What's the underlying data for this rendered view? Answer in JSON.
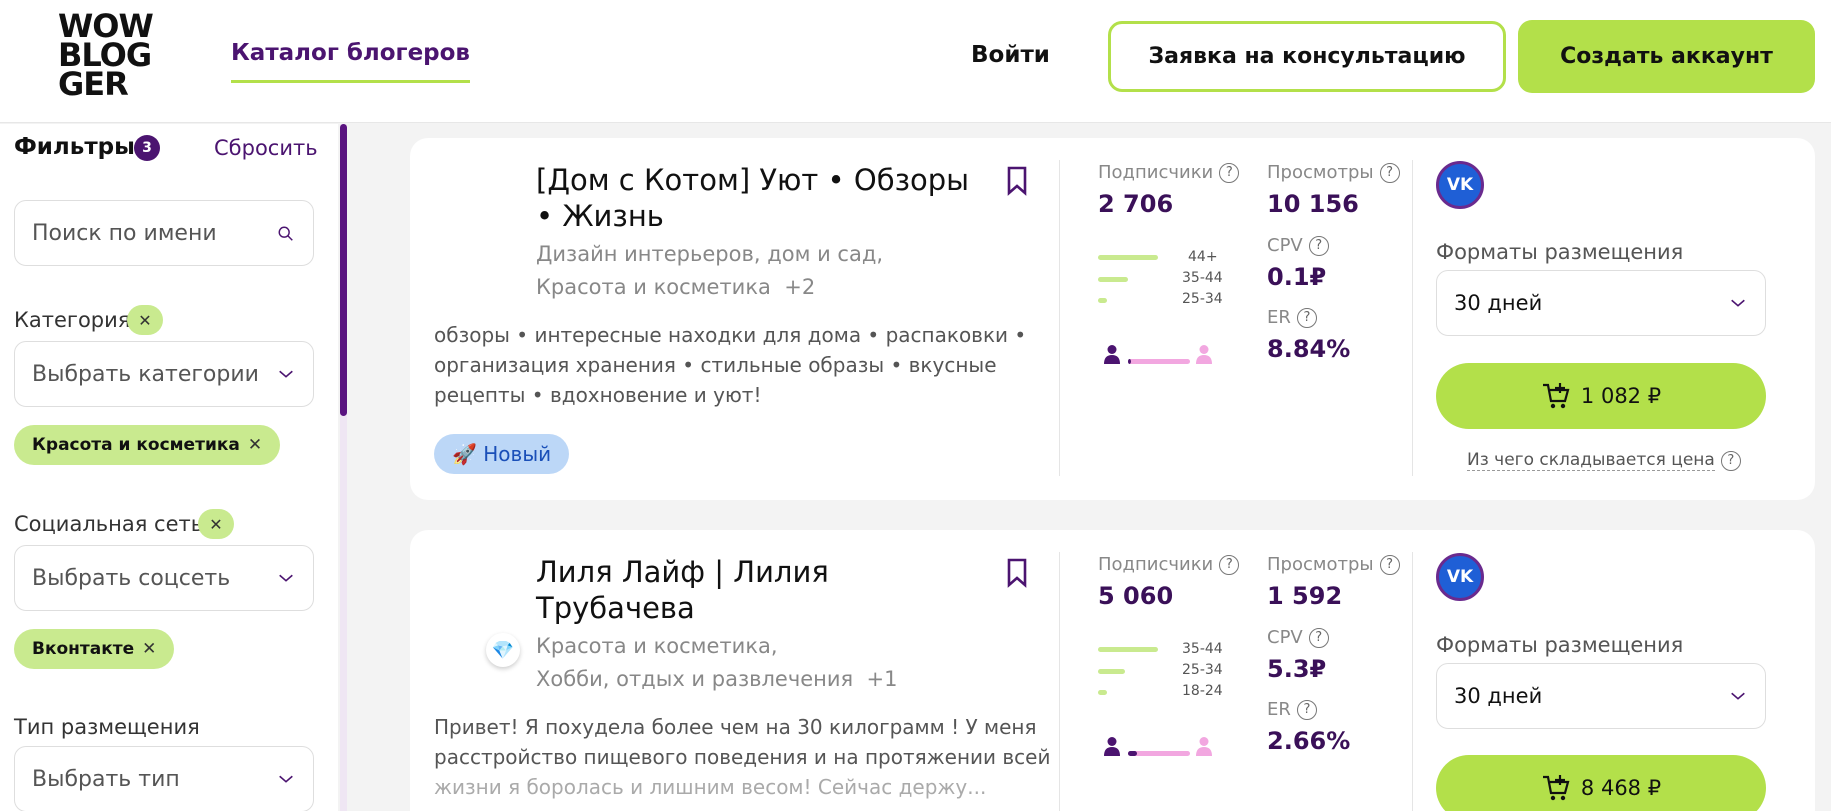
{
  "header": {
    "logo": [
      "WOW",
      "BLOG",
      "GER"
    ],
    "nav_catalog": "Каталог блогеров",
    "login": "Войти",
    "consult_btn": "Заявка на консультацию",
    "create_btn": "Создать аккаунт",
    "accent_color": "#b3e04a",
    "brand_color": "#4b1470"
  },
  "filters": {
    "title": "Фильтры",
    "count": "3",
    "reset": "Сбросить",
    "search_placeholder": "Поиск по имени",
    "category_label": "Категория",
    "category_placeholder": "Выбрать категории",
    "category_tag": "Красота и косметика",
    "social_label": "Социальная сеть",
    "social_placeholder": "Выбрать соцсеть",
    "social_tag": "Вконтакте",
    "type_label": "Тип размещения",
    "type_placeholder": "Выбрать тип"
  },
  "cards": [
    {
      "title_line1": "[Дом с Котом] Уют • Обзоры",
      "title_line2": "• Жизнь",
      "cats_line1": "Дизайн интерьеров, дом и сад,",
      "cats_line2": "Красота и косметика",
      "cats_more": "+2",
      "desc_line1": "обзоры • интересные находки для дома • распаковки •",
      "desc_line2": "организация хранения • стильные образы • вкусные",
      "desc_line3": "рецепты • вдохновение и уют!",
      "badge": "🚀 Новый",
      "subs_label": "Подписчики",
      "subs": "2 706",
      "views_label": "Просмотры",
      "views": "10 156",
      "cpv_label": "CPV",
      "cpv": "0.1₽",
      "er_label": "ER",
      "er": "8.84%",
      "ages": [
        "44+",
        "35-44",
        "25-34"
      ],
      "age_shares": [
        1.0,
        0.5,
        0.15
      ],
      "male_share": 0.05,
      "network": "VK",
      "formats_label": "Форматы размещения",
      "format": "30 дней",
      "price": "1 082 ₽",
      "price_note": "Из чего складывается цена"
    },
    {
      "title_line1": "Лиля Лайф | Лилия",
      "title_line2": "Трубачева",
      "cats_line1": "Красота и косметика,",
      "cats_line2": "Хобби, отдых и развлечения",
      "cats_more": "+1",
      "desc_line1": "Привет! Я похудела более чем на 30 килограмм ! У меня",
      "desc_line2": "расстройство пищевого поведения и на протяжении всей",
      "desc_line3": "жизни я боролась и лишним весом! Сейчас держу...",
      "subs_label": "Подписчики",
      "subs": "5 060",
      "views_label": "Просмотры",
      "views": "1 592",
      "cpv_label": "CPV",
      "cpv": "5.3₽",
      "er_label": "ER",
      "er": "2.66%",
      "ages": [
        "35-44",
        "25-34",
        "18-24"
      ],
      "age_shares": [
        1.0,
        0.45,
        0.15
      ],
      "male_share": 0.15,
      "network": "VK",
      "formats_label": "Форматы размещения",
      "format": "30 дней",
      "price": "8 468 ₽"
    }
  ]
}
